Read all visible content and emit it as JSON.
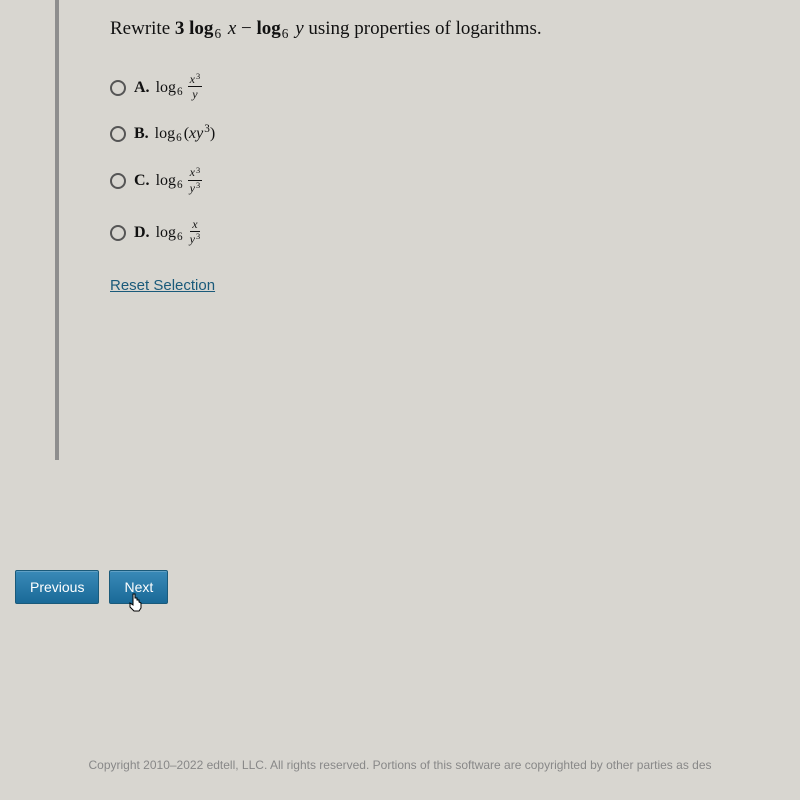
{
  "question": {
    "prefix": "Rewrite ",
    "suffix": " using properties of logarithms."
  },
  "options": {
    "a": {
      "letter": "A."
    },
    "b": {
      "letter": "B."
    },
    "c": {
      "letter": "C."
    },
    "d": {
      "letter": "D."
    }
  },
  "math": {
    "log": "log",
    "base6": "6",
    "x": "x",
    "y": "y",
    "x3": "3",
    "y3": "3",
    "three": "3",
    "minus": "−"
  },
  "reset_label": "Reset Selection",
  "nav": {
    "previous": "Previous",
    "next": "Next"
  },
  "footer": "Copyright 2010–2022 edtell, LLC. All rights reserved. Portions of this software are copyrighted by other parties as des"
}
